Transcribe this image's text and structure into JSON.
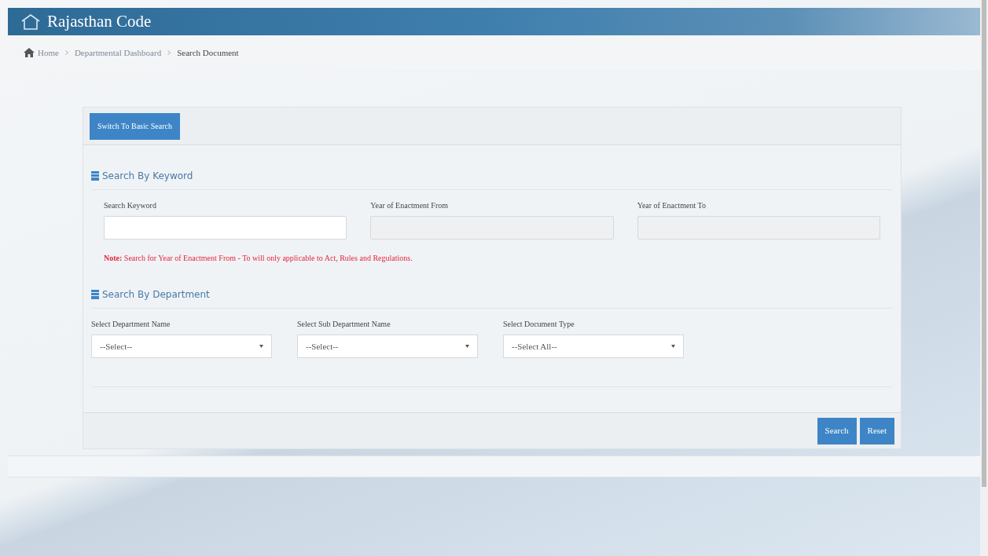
{
  "header": {
    "title": "Rajasthan Code"
  },
  "breadcrumb": [
    "Home",
    "Departmental Dashboard",
    "Search Document"
  ],
  "switch_button": "Switch To Basic Search",
  "keyword_section": {
    "heading": "Search By Keyword",
    "fields": [
      {
        "label": "Search Keyword",
        "disabled": false
      },
      {
        "label": "Year of Enactment From",
        "disabled": true
      },
      {
        "label": "Year of Enactment To",
        "disabled": true
      }
    ],
    "note": "**Note:** Search for Year of Enactment From - To will only applicable to Act, Rules and Regulations."
  },
  "department_section": {
    "heading": "Search By Department",
    "selects": [
      {
        "label": "Select Department Name",
        "value": "--Select--"
      },
      {
        "label": "Select Sub Department Name",
        "value": "--Select--"
      },
      {
        "label": "Select Document Type",
        "value": "--Select All--"
      }
    ]
  },
  "buttons": [
    "Search",
    "Reset"
  ]
}
